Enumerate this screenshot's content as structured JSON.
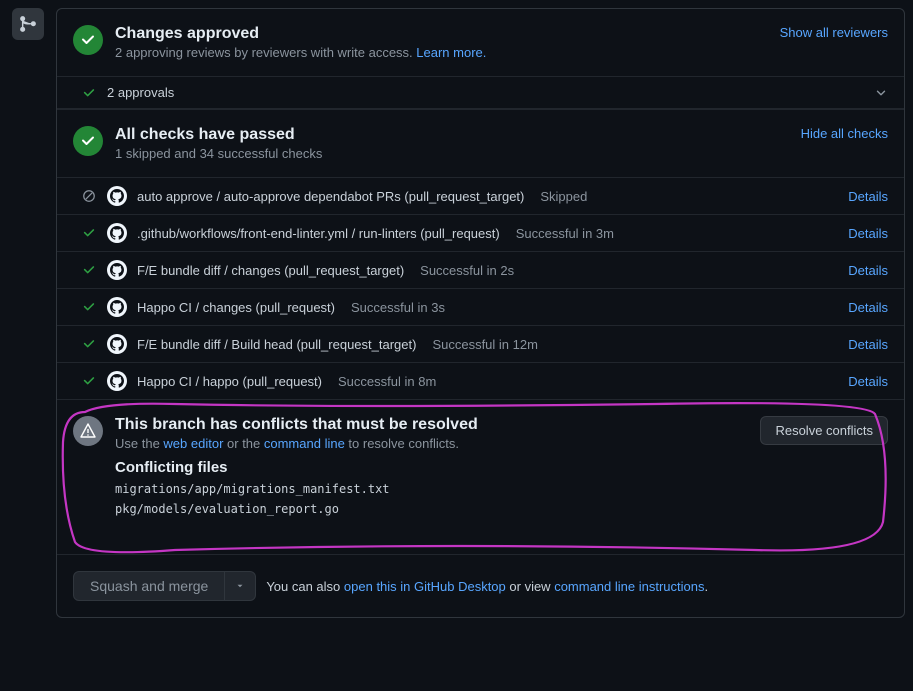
{
  "approved": {
    "title": "Changes approved",
    "subtitle_prefix": "2 approving reviews by reviewers with write access. ",
    "learn_more": "Learn more.",
    "show_reviewers": "Show all reviewers",
    "approvals_count": "2 approvals"
  },
  "checks": {
    "title": "All checks have passed",
    "subtitle": "1 skipped and 34 successful checks",
    "hide_link": "Hide all checks",
    "details_label": "Details",
    "items": [
      {
        "status": "skipped",
        "name": "auto approve / auto-approve dependabot PRs (pull_request_target)",
        "result": "Skipped"
      },
      {
        "status": "success",
        "name": ".github/workflows/front-end-linter.yml / run-linters (pull_request)",
        "result": "Successful in 3m"
      },
      {
        "status": "success",
        "name": "F/E bundle diff / changes (pull_request_target)",
        "result": "Successful in 2s"
      },
      {
        "status": "success",
        "name": "Happo CI / changes (pull_request)",
        "result": "Successful in 3s"
      },
      {
        "status": "success",
        "name": "F/E bundle diff / Build head (pull_request_target)",
        "result": "Successful in 12m"
      },
      {
        "status": "success",
        "name": "Happo CI / happo (pull_request)",
        "result": "Successful in 8m"
      }
    ]
  },
  "conflict": {
    "title": "This branch has conflicts that must be resolved",
    "sub_prefix": "Use the ",
    "web_editor": "web editor",
    "sub_mid": " or the ",
    "command_line": "command line",
    "sub_suffix": " to resolve conflicts.",
    "files_heading": "Conflicting files",
    "files": [
      "migrations/app/migrations_manifest.txt",
      "pkg/models/evaluation_report.go"
    ],
    "resolve_button": "Resolve conflicts"
  },
  "footer": {
    "merge_label": "Squash and merge",
    "text_prefix": "You can also ",
    "desktop_link": "open this in GitHub Desktop",
    "text_mid": " or view ",
    "cli_link": "command line instructions",
    "text_suffix": "."
  }
}
